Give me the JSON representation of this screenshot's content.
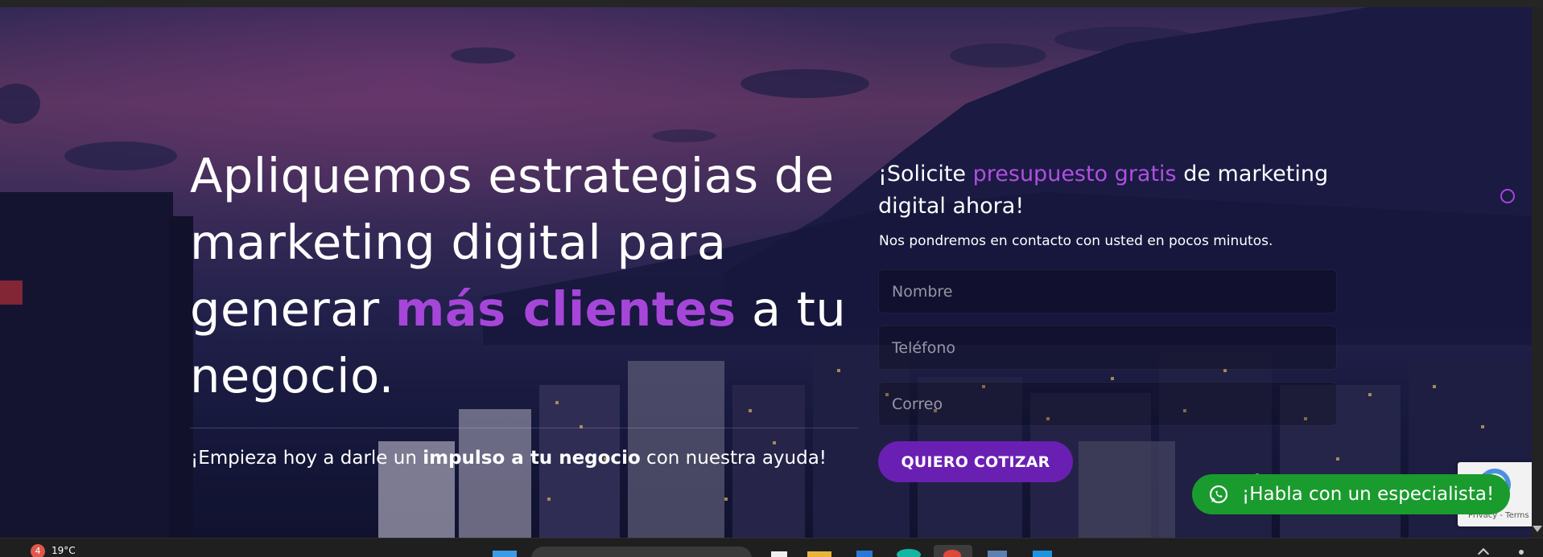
{
  "hero": {
    "headline_part1": "Apliquemos estrategias de marketing digital para generar ",
    "headline_highlight": "más clientes",
    "headline_part2": " a tu negocio.",
    "subline_pre": "¡Empieza hoy a darle un ",
    "subline_bold": "impulso a tu negocio",
    "subline_post": " con nuestra ayuda!"
  },
  "form": {
    "title_pre": "¡Solicite ",
    "title_highlight": "presupuesto gratis",
    "title_post": " de marketing digital ahora!",
    "subtitle": "Nos pondremos en contacto con usted en pocos minutos.",
    "name_placeholder": "Nombre",
    "phone_placeholder": "Teléfono",
    "email_placeholder": "Correo",
    "submit_label": "QUIERO COTIZAR"
  },
  "whatsapp": {
    "label": "¡Habla con un especialista!"
  },
  "recaptcha": {
    "terms": "Privacy - Terms"
  },
  "taskbar": {
    "weather_badge": "4",
    "temperature": "19°C"
  },
  "colors": {
    "accent": "#a646d9",
    "button": "#6a1fb3",
    "whatsapp": "#1a9b2e"
  },
  "icons": {
    "whatsapp": "whatsapp-icon",
    "recaptcha": "recaptcha-icon"
  }
}
